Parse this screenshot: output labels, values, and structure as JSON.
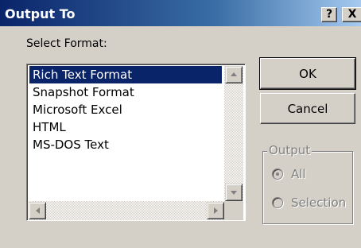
{
  "window": {
    "title": "Output To",
    "help_label": "?",
    "close_label": "X"
  },
  "format": {
    "label": "Select Format:",
    "items": [
      {
        "label": "Rich Text Format",
        "selected": true
      },
      {
        "label": "Snapshot Format",
        "selected": false
      },
      {
        "label": "Microsoft Excel",
        "selected": false
      },
      {
        "label": "HTML",
        "selected": false
      },
      {
        "label": "MS-DOS Text",
        "selected": false
      }
    ]
  },
  "buttons": {
    "ok_label": "OK",
    "cancel_label": "Cancel"
  },
  "output": {
    "group_label": "Output",
    "all_label": "All",
    "selection_label": "Selection",
    "selected_option": "All",
    "enabled": false
  },
  "colors": {
    "dialog_bg": "#d4d0c8",
    "title_bar": "#0a246a",
    "selection_bg": "#0a246a",
    "disabled_text": "#808080"
  },
  "icons": {
    "help": "question-mark-icon",
    "close": "close-icon",
    "scroll_up": "scroll-up-arrow-icon",
    "scroll_down": "scroll-down-arrow-icon",
    "scroll_left": "scroll-left-arrow-icon",
    "scroll_right": "scroll-right-arrow-icon"
  }
}
